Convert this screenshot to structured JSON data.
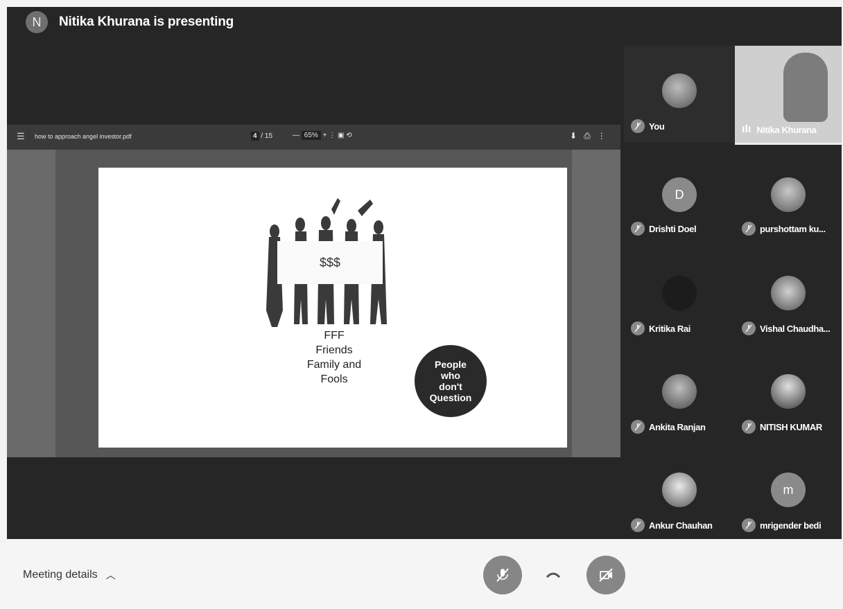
{
  "presenter": {
    "initial": "N",
    "text": "Nitika Khurana is presenting"
  },
  "pdf": {
    "file_name": "how to approach angel investor.pdf",
    "page": "4",
    "page_total": "/ 15",
    "zoom": "65%",
    "slide": {
      "sign_text": "$$$",
      "caption_lines": [
        "FFF",
        "Friends",
        "Family and",
        "Fools"
      ],
      "circle_lines": [
        "People",
        "who",
        "don't",
        "Question"
      ]
    }
  },
  "participants": [
    {
      "name": "You",
      "avatar": "photo"
    },
    {
      "name": "Nitika Khurana",
      "avatar": "video"
    },
    {
      "name": "Drishti Doel",
      "avatar": "initial",
      "initial": "D"
    },
    {
      "name": "purshottam ku...",
      "avatar": "photo"
    },
    {
      "name": "Kritika Rai",
      "avatar": "photo"
    },
    {
      "name": "Vishal Chaudha...",
      "avatar": "photo"
    },
    {
      "name": "Ankita Ranjan",
      "avatar": "photo"
    },
    {
      "name": "NITISH KUMAR",
      "avatar": "photo"
    },
    {
      "name": "Ankur Chauhan",
      "avatar": "photo"
    },
    {
      "name": "mrigender bedi",
      "avatar": "initial",
      "initial": "m"
    }
  ],
  "footer": {
    "meeting_details": "Meeting details",
    "controls": [
      "mic-off-icon",
      "hang-up-icon",
      "camera-off-icon"
    ]
  },
  "colors": {
    "stage_bg": "#262626",
    "panel_bg": "#3a3a3a",
    "control_bg": "#868686"
  }
}
